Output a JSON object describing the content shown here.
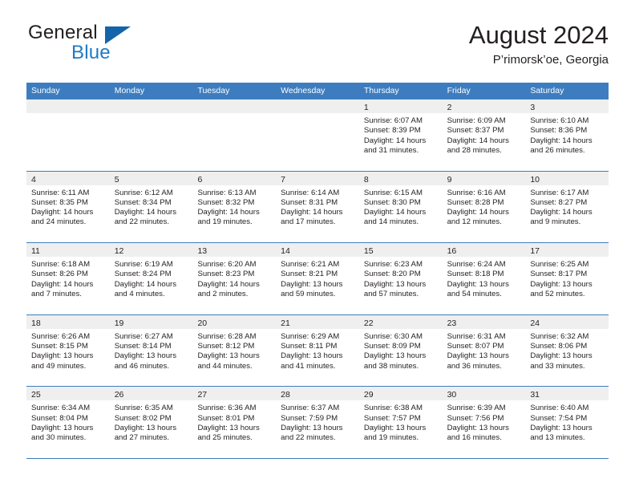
{
  "brand": {
    "name_part1": "General",
    "name_part2": "Blue",
    "logo_icon": "triangle-logo-icon"
  },
  "header": {
    "month_title": "August 2024",
    "location": "P’rimorsk’oe, Georgia"
  },
  "calendar": {
    "weekdays": [
      "Sunday",
      "Monday",
      "Tuesday",
      "Wednesday",
      "Thursday",
      "Friday",
      "Saturday"
    ],
    "colors": {
      "header_blue": "#3d7dbf",
      "day_band_gray": "#efefef",
      "brand_blue": "#1f7ac4",
      "logo_blue": "#1464aa",
      "text": "#231f20"
    },
    "weeks": [
      [
        {
          "day": "",
          "sunrise": "",
          "sunset": "",
          "daylight1": "",
          "daylight2": ""
        },
        {
          "day": "",
          "sunrise": "",
          "sunset": "",
          "daylight1": "",
          "daylight2": ""
        },
        {
          "day": "",
          "sunrise": "",
          "sunset": "",
          "daylight1": "",
          "daylight2": ""
        },
        {
          "day": "",
          "sunrise": "",
          "sunset": "",
          "daylight1": "",
          "daylight2": ""
        },
        {
          "day": "1",
          "sunrise": "Sunrise: 6:07 AM",
          "sunset": "Sunset: 8:39 PM",
          "daylight1": "Daylight: 14 hours",
          "daylight2": "and 31 minutes."
        },
        {
          "day": "2",
          "sunrise": "Sunrise: 6:09 AM",
          "sunset": "Sunset: 8:37 PM",
          "daylight1": "Daylight: 14 hours",
          "daylight2": "and 28 minutes."
        },
        {
          "day": "3",
          "sunrise": "Sunrise: 6:10 AM",
          "sunset": "Sunset: 8:36 PM",
          "daylight1": "Daylight: 14 hours",
          "daylight2": "and 26 minutes."
        }
      ],
      [
        {
          "day": "4",
          "sunrise": "Sunrise: 6:11 AM",
          "sunset": "Sunset: 8:35 PM",
          "daylight1": "Daylight: 14 hours",
          "daylight2": "and 24 minutes."
        },
        {
          "day": "5",
          "sunrise": "Sunrise: 6:12 AM",
          "sunset": "Sunset: 8:34 PM",
          "daylight1": "Daylight: 14 hours",
          "daylight2": "and 22 minutes."
        },
        {
          "day": "6",
          "sunrise": "Sunrise: 6:13 AM",
          "sunset": "Sunset: 8:32 PM",
          "daylight1": "Daylight: 14 hours",
          "daylight2": "and 19 minutes."
        },
        {
          "day": "7",
          "sunrise": "Sunrise: 6:14 AM",
          "sunset": "Sunset: 8:31 PM",
          "daylight1": "Daylight: 14 hours",
          "daylight2": "and 17 minutes."
        },
        {
          "day": "8",
          "sunrise": "Sunrise: 6:15 AM",
          "sunset": "Sunset: 8:30 PM",
          "daylight1": "Daylight: 14 hours",
          "daylight2": "and 14 minutes."
        },
        {
          "day": "9",
          "sunrise": "Sunrise: 6:16 AM",
          "sunset": "Sunset: 8:28 PM",
          "daylight1": "Daylight: 14 hours",
          "daylight2": "and 12 minutes."
        },
        {
          "day": "10",
          "sunrise": "Sunrise: 6:17 AM",
          "sunset": "Sunset: 8:27 PM",
          "daylight1": "Daylight: 14 hours",
          "daylight2": "and 9 minutes."
        }
      ],
      [
        {
          "day": "11",
          "sunrise": "Sunrise: 6:18 AM",
          "sunset": "Sunset: 8:26 PM",
          "daylight1": "Daylight: 14 hours",
          "daylight2": "and 7 minutes."
        },
        {
          "day": "12",
          "sunrise": "Sunrise: 6:19 AM",
          "sunset": "Sunset: 8:24 PM",
          "daylight1": "Daylight: 14 hours",
          "daylight2": "and 4 minutes."
        },
        {
          "day": "13",
          "sunrise": "Sunrise: 6:20 AM",
          "sunset": "Sunset: 8:23 PM",
          "daylight1": "Daylight: 14 hours",
          "daylight2": "and 2 minutes."
        },
        {
          "day": "14",
          "sunrise": "Sunrise: 6:21 AM",
          "sunset": "Sunset: 8:21 PM",
          "daylight1": "Daylight: 13 hours",
          "daylight2": "and 59 minutes."
        },
        {
          "day": "15",
          "sunrise": "Sunrise: 6:23 AM",
          "sunset": "Sunset: 8:20 PM",
          "daylight1": "Daylight: 13 hours",
          "daylight2": "and 57 minutes."
        },
        {
          "day": "16",
          "sunrise": "Sunrise: 6:24 AM",
          "sunset": "Sunset: 8:18 PM",
          "daylight1": "Daylight: 13 hours",
          "daylight2": "and 54 minutes."
        },
        {
          "day": "17",
          "sunrise": "Sunrise: 6:25 AM",
          "sunset": "Sunset: 8:17 PM",
          "daylight1": "Daylight: 13 hours",
          "daylight2": "and 52 minutes."
        }
      ],
      [
        {
          "day": "18",
          "sunrise": "Sunrise: 6:26 AM",
          "sunset": "Sunset: 8:15 PM",
          "daylight1": "Daylight: 13 hours",
          "daylight2": "and 49 minutes."
        },
        {
          "day": "19",
          "sunrise": "Sunrise: 6:27 AM",
          "sunset": "Sunset: 8:14 PM",
          "daylight1": "Daylight: 13 hours",
          "daylight2": "and 46 minutes."
        },
        {
          "day": "20",
          "sunrise": "Sunrise: 6:28 AM",
          "sunset": "Sunset: 8:12 PM",
          "daylight1": "Daylight: 13 hours",
          "daylight2": "and 44 minutes."
        },
        {
          "day": "21",
          "sunrise": "Sunrise: 6:29 AM",
          "sunset": "Sunset: 8:11 PM",
          "daylight1": "Daylight: 13 hours",
          "daylight2": "and 41 minutes."
        },
        {
          "day": "22",
          "sunrise": "Sunrise: 6:30 AM",
          "sunset": "Sunset: 8:09 PM",
          "daylight1": "Daylight: 13 hours",
          "daylight2": "and 38 minutes."
        },
        {
          "day": "23",
          "sunrise": "Sunrise: 6:31 AM",
          "sunset": "Sunset: 8:07 PM",
          "daylight1": "Daylight: 13 hours",
          "daylight2": "and 36 minutes."
        },
        {
          "day": "24",
          "sunrise": "Sunrise: 6:32 AM",
          "sunset": "Sunset: 8:06 PM",
          "daylight1": "Daylight: 13 hours",
          "daylight2": "and 33 minutes."
        }
      ],
      [
        {
          "day": "25",
          "sunrise": "Sunrise: 6:34 AM",
          "sunset": "Sunset: 8:04 PM",
          "daylight1": "Daylight: 13 hours",
          "daylight2": "and 30 minutes."
        },
        {
          "day": "26",
          "sunrise": "Sunrise: 6:35 AM",
          "sunset": "Sunset: 8:02 PM",
          "daylight1": "Daylight: 13 hours",
          "daylight2": "and 27 minutes."
        },
        {
          "day": "27",
          "sunrise": "Sunrise: 6:36 AM",
          "sunset": "Sunset: 8:01 PM",
          "daylight1": "Daylight: 13 hours",
          "daylight2": "and 25 minutes."
        },
        {
          "day": "28",
          "sunrise": "Sunrise: 6:37 AM",
          "sunset": "Sunset: 7:59 PM",
          "daylight1": "Daylight: 13 hours",
          "daylight2": "and 22 minutes."
        },
        {
          "day": "29",
          "sunrise": "Sunrise: 6:38 AM",
          "sunset": "Sunset: 7:57 PM",
          "daylight1": "Daylight: 13 hours",
          "daylight2": "and 19 minutes."
        },
        {
          "day": "30",
          "sunrise": "Sunrise: 6:39 AM",
          "sunset": "Sunset: 7:56 PM",
          "daylight1": "Daylight: 13 hours",
          "daylight2": "and 16 minutes."
        },
        {
          "day": "31",
          "sunrise": "Sunrise: 6:40 AM",
          "sunset": "Sunset: 7:54 PM",
          "daylight1": "Daylight: 13 hours",
          "daylight2": "and 13 minutes."
        }
      ]
    ]
  }
}
